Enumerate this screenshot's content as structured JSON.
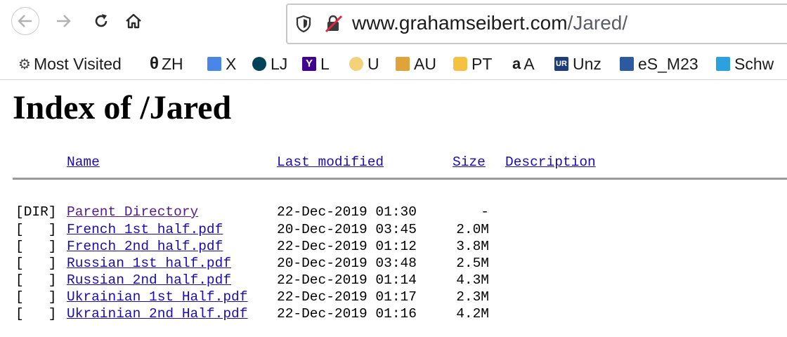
{
  "browser": {
    "url_domain": "www.grahamseibert.com",
    "url_path": "/Jared/",
    "bookmarks": [
      {
        "label": "Most Visited",
        "icon": "gear-icon",
        "glyph": "⚙",
        "color": "#444444"
      },
      {
        "label": "ZH",
        "icon": "theta-icon",
        "glyph": "θ",
        "color": "#000000"
      },
      {
        "label": "X",
        "icon": "translate-icon",
        "glyph": "",
        "color": "#4a86e8"
      },
      {
        "label": "LJ",
        "icon": "livejournal-icon",
        "glyph": "",
        "color": "#004359"
      },
      {
        "label": "L",
        "icon": "yahoo-icon",
        "glyph": "Y",
        "color": "#400090"
      },
      {
        "label": "U",
        "icon": "circle-icon",
        "glyph": "",
        "color": "#f3d27a"
      },
      {
        "label": "AU",
        "icon": "s-logo-icon",
        "glyph": "",
        "color": "#e0a33a"
      },
      {
        "label": "PT",
        "icon": "pt-icon",
        "glyph": "",
        "color": "#f6c143"
      },
      {
        "label": "A",
        "icon": "amazon-icon",
        "glyph": "a",
        "color": "#000000"
      },
      {
        "label": "Unz",
        "icon": "ur-icon",
        "glyph": "UR",
        "color": "#1f3d7a"
      },
      {
        "label": "eS_M23",
        "icon": "es-icon",
        "glyph": "",
        "color": "#2c5aa0"
      },
      {
        "label": "Schw",
        "icon": "schwab-icon",
        "glyph": "",
        "color": "#2aa2e0"
      }
    ]
  },
  "page": {
    "title": "Index of /Jared",
    "columns": {
      "name": "Name",
      "modified": "Last modified",
      "size": "Size",
      "description": "Description"
    },
    "rows": [
      {
        "icon": "[DIR]",
        "name": "Parent Directory",
        "modified": "22-Dec-2019 01:30",
        "size": "-"
      },
      {
        "icon": "[   ]",
        "name": "French_1st_half.pdf",
        "modified": "20-Dec-2019 03:45",
        "size": "2.0M"
      },
      {
        "icon": "[   ]",
        "name": "French_2nd_half.pdf",
        "modified": "22-Dec-2019 01:12",
        "size": "3.8M"
      },
      {
        "icon": "[   ]",
        "name": "Russian_1st_half.pdf",
        "modified": "20-Dec-2019 03:48",
        "size": "2.5M"
      },
      {
        "icon": "[   ]",
        "name": "Russian_2nd_half.pdf",
        "modified": "22-Dec-2019 01:14",
        "size": "4.3M"
      },
      {
        "icon": "[   ]",
        "name": "Ukrainian_1st_Half.pdf",
        "modified": "22-Dec-2019 01:17",
        "size": "2.3M"
      },
      {
        "icon": "[   ]",
        "name": "Ukrainian_2nd_Half.pdf",
        "modified": "22-Dec-2019 01:16",
        "size": "4.2M"
      }
    ]
  }
}
